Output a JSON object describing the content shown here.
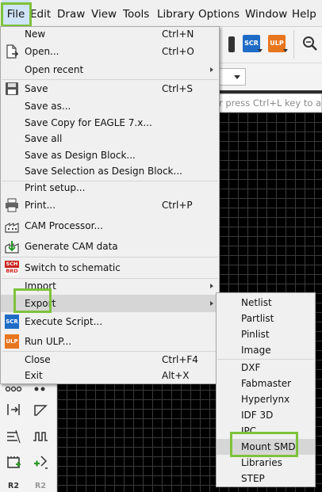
{
  "menubar": {
    "items": [
      "File",
      "Edit",
      "Draw",
      "View",
      "Tools",
      "Library",
      "Options",
      "Window",
      "Help"
    ]
  },
  "toolbar": {
    "scr_label": "SCR",
    "ulp_label": "ULP"
  },
  "command_line": {
    "placeholder": "r press Ctrl+L key to ac"
  },
  "file_menu": {
    "new": {
      "label": "New",
      "shortcut": "Ctrl+N"
    },
    "open": {
      "label": "Open...",
      "shortcut": "Ctrl+O"
    },
    "open_recent": {
      "label": "Open recent"
    },
    "save": {
      "label": "Save",
      "shortcut": "Ctrl+S"
    },
    "save_as": {
      "label": "Save as..."
    },
    "save_copy": {
      "label": "Save Copy for EAGLE 7.x..."
    },
    "save_all": {
      "label": "Save all"
    },
    "save_design_block": {
      "label": "Save as Design Block..."
    },
    "save_selection": {
      "label": "Save Selection as Design Block..."
    },
    "print_setup": {
      "label": "Print setup..."
    },
    "print": {
      "label": "Print...",
      "shortcut": "Ctrl+P"
    },
    "cam_processor": {
      "label": "CAM Processor..."
    },
    "generate_cam": {
      "label": "Generate CAM data"
    },
    "switch_schematic": {
      "label": "Switch to schematic",
      "icon_text_top": "SCH",
      "icon_text_bottom": "BRD"
    },
    "import": {
      "label": "Import"
    },
    "export": {
      "label": "Export"
    },
    "execute_script": {
      "label": "Execute Script...",
      "icon_text": "SCR"
    },
    "run_ulp": {
      "label": "Run ULP...",
      "icon_text": "ULP"
    },
    "close": {
      "label": "Close",
      "shortcut": "Ctrl+F4"
    },
    "exit": {
      "label": "Exit",
      "shortcut": "Alt+X"
    }
  },
  "export_menu": {
    "items": [
      "Netlist",
      "Partlist",
      "Pinlist",
      "Image",
      "DXF",
      "Fabmaster",
      "Hyperlynx",
      "IDF 3D",
      "IPC",
      "Mount SMD",
      "Libraries",
      "STEP"
    ]
  },
  "left_toolbar": {
    "r2_label_a": "R2",
    "r2_label_b": "R2"
  },
  "colors": {
    "accent_highlight": "#7ec23a",
    "scr_blue": "#1f6cc7",
    "ulp_orange": "#e8761e",
    "sch_red": "#c8211c"
  }
}
